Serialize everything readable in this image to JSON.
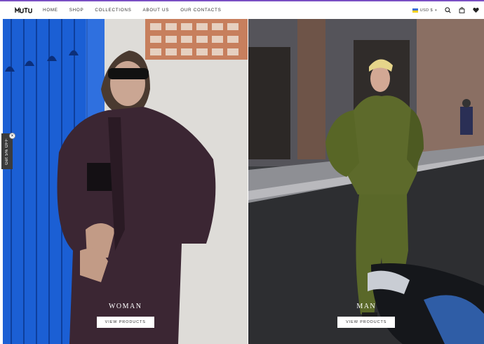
{
  "header": {
    "logo_text": "MUTU",
    "nav": [
      "HOME",
      "SHOP",
      "COLLECTIONS",
      "ABOUT US",
      "OUR CONTACTS"
    ],
    "currency": "USD $",
    "icons": [
      "flag-ukraine-icon",
      "search-icon",
      "bag-icon",
      "heart-icon"
    ]
  },
  "panels": [
    {
      "title": "WOMAN",
      "button": "VIEW PRODUCTS"
    },
    {
      "title": "MAN",
      "button": "VIEW PRODUCTS"
    }
  ],
  "promo_tab": {
    "label": "Get 5% OFF",
    "close": "✕"
  },
  "colors": {
    "accent": "#7a4fc4",
    "door_blue": "#1a5fd6",
    "jacket_purple": "#3d2a35",
    "olive": "#5b6a2a"
  }
}
